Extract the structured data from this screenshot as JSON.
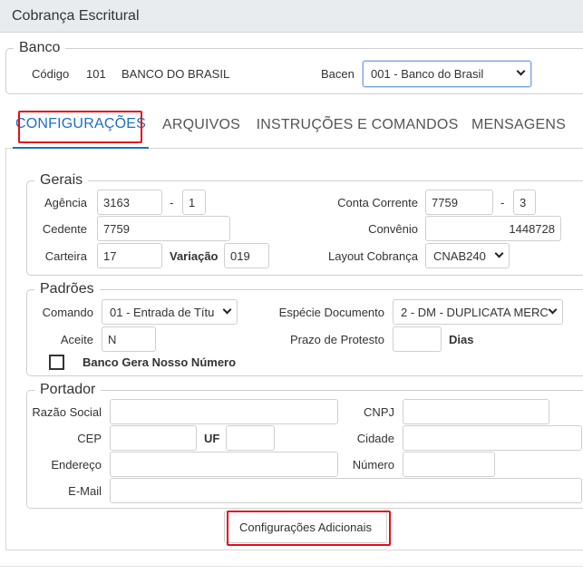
{
  "window": {
    "title": "Cobrança Escritural"
  },
  "banco": {
    "legend": "Banco",
    "codigo_label": "Código",
    "codigo_value": "101",
    "nome": "BANCO DO BRASIL",
    "bacen_label": "Bacen",
    "bacen_value": "001 - Banco do Brasil"
  },
  "tabs": [
    {
      "label": "CONFIGURAÇÕES",
      "active": true
    },
    {
      "label": "ARQUIVOS"
    },
    {
      "label": "INSTRUÇÕES E COMANDOS"
    },
    {
      "label": "MENSAGENS"
    }
  ],
  "gerais": {
    "legend": "Gerais",
    "agencia_label": "Agência",
    "agencia_value": "3163",
    "agencia_dv": "1",
    "dash1": "-",
    "conta_label": "Conta Corrente",
    "conta_value": "7759",
    "dash2": "-",
    "conta_dv": "3",
    "cedente_label": "Cedente",
    "cedente_value": "7759",
    "convenio_label": "Convênio",
    "convenio_value": "1448728",
    "carteira_label": "Carteira",
    "carteira_value": "17",
    "variacao_label": "Variação",
    "variacao_value": "019",
    "layout_label": "Layout Cobrança",
    "layout_value": "CNAB240"
  },
  "padroes": {
    "legend": "Padrões",
    "comando_label": "Comando",
    "comando_value": "01 - Entrada de Títu",
    "especie_label": "Espécie Documento",
    "especie_value": "2 - DM - DUPLICATA MERC",
    "aceite_label": "Aceite",
    "aceite_value": "N",
    "prazo_label": "Prazo de Protesto",
    "prazo_value": "",
    "dias_label": "Dias",
    "banco_gera_label": "Banco Gera Nosso Número",
    "banco_gera_checked": false
  },
  "portador": {
    "legend": "Portador",
    "razao_label": "Razão Social",
    "razao_value": "",
    "cnpj_label": "CNPJ",
    "cnpj_value": "",
    "cep_label": "CEP",
    "cep_value": "",
    "uf_label": "UF",
    "uf_value": "",
    "cidade_label": "Cidade",
    "cidade_value": "",
    "endereco_label": "Endereço",
    "endereco_value": "",
    "numero_label": "Número",
    "numero_value": "",
    "email_label": "E-Mail",
    "email_value": ""
  },
  "actions": {
    "config_adicionais": "Configurações Adicionais"
  },
  "colors": {
    "accent": "#1e6fc1",
    "highlight": "#e0111b",
    "titlebar": "#e8ecef"
  },
  "icons": {
    "select": "chevron-down-icon",
    "checkbox": "checkbox-icon"
  }
}
